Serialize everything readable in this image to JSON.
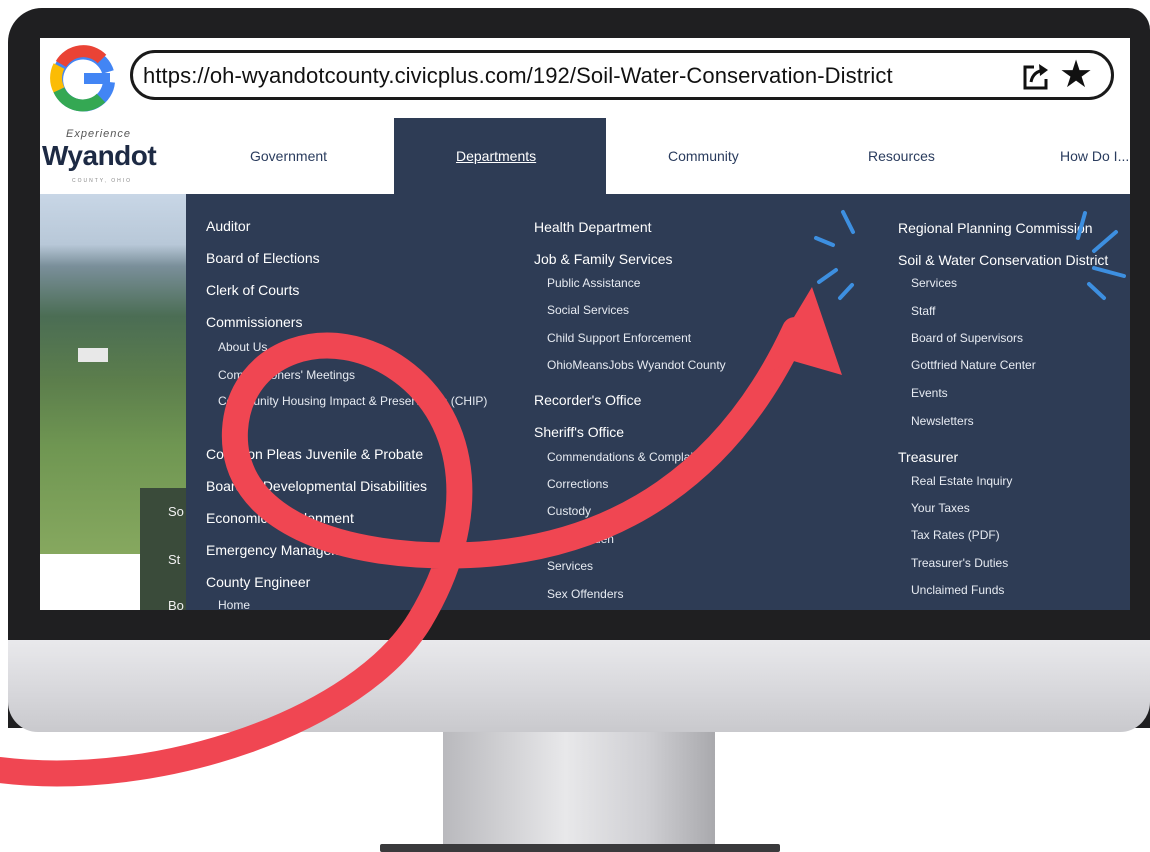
{
  "browser": {
    "url": "https://oh-wyandotcounty.civicplus.com/192/Soil-Water-Conservation-District",
    "icons": [
      "google-g-icon",
      "share-icon",
      "star-icon"
    ]
  },
  "site": {
    "logo_small": "Experience",
    "logo_main": "Wyandot",
    "logo_tag": "COUNTY, OHIO"
  },
  "nav": {
    "government": "Government",
    "departments": "Departments",
    "community": "Community",
    "resources": "Resources",
    "how_do_i": "How Do I..."
  },
  "side_panel": [
    "So",
    "St",
    "Bo"
  ],
  "menu": {
    "col1": {
      "auditor": "Auditor",
      "board_elections": "Board of Elections",
      "clerk_courts": "Clerk of Courts",
      "commissioners": "Commissioners",
      "about_us": "About Us",
      "commissioners_meetings": "Commissioners' Meetings",
      "chip": "Community Housing Impact & Preservation (CHIP)",
      "common_pleas": "Common Pleas Juvenile & Probate",
      "board_dd": "Board of Developmental Disabilities",
      "economic_dev": "Economic Development",
      "emergency": "Emergency Management",
      "county_engineer": "County Engineer",
      "home": "Home"
    },
    "col2": {
      "health": "Health Department",
      "jfs": "Job & Family Services",
      "public_assistance": "Public Assistance",
      "social_services": "Social Services",
      "child_support": "Child Support Enforcement",
      "ohiomeansjobs": "OhioMeansJobs Wyandot County",
      "recorder": "Recorder's Office",
      "sheriff": "Sheriff's Office",
      "commendations": "Commendations & Complaints",
      "corrections": "Corrections",
      "custody": "Custody",
      "dog_warden": "Dog Warden",
      "services": "Services",
      "sex_offenders": "Sex Offenders"
    },
    "col3": {
      "regional_planning": "Regional Planning Commission",
      "soil_water": "Soil & Water Conservation District",
      "services": "Services",
      "staff": "Staff",
      "board_supervisors": "Board of Supervisors",
      "gottfried": "Gottfried Nature Center",
      "events": "Events",
      "newsletters": "Newsletters",
      "treasurer": "Treasurer",
      "real_estate": "Real Estate Inquiry",
      "your_taxes": "Your Taxes",
      "tax_rates": "Tax Rates (PDF)",
      "treasurer_duties": "Treasurer's Duties",
      "unclaimed": "Unclaimed Funds"
    }
  },
  "colors": {
    "menu_bg": "#2e3c55",
    "arrow": "#f04652",
    "highlight": "#3d8fe0",
    "nav_text": "#2a3c5e"
  }
}
